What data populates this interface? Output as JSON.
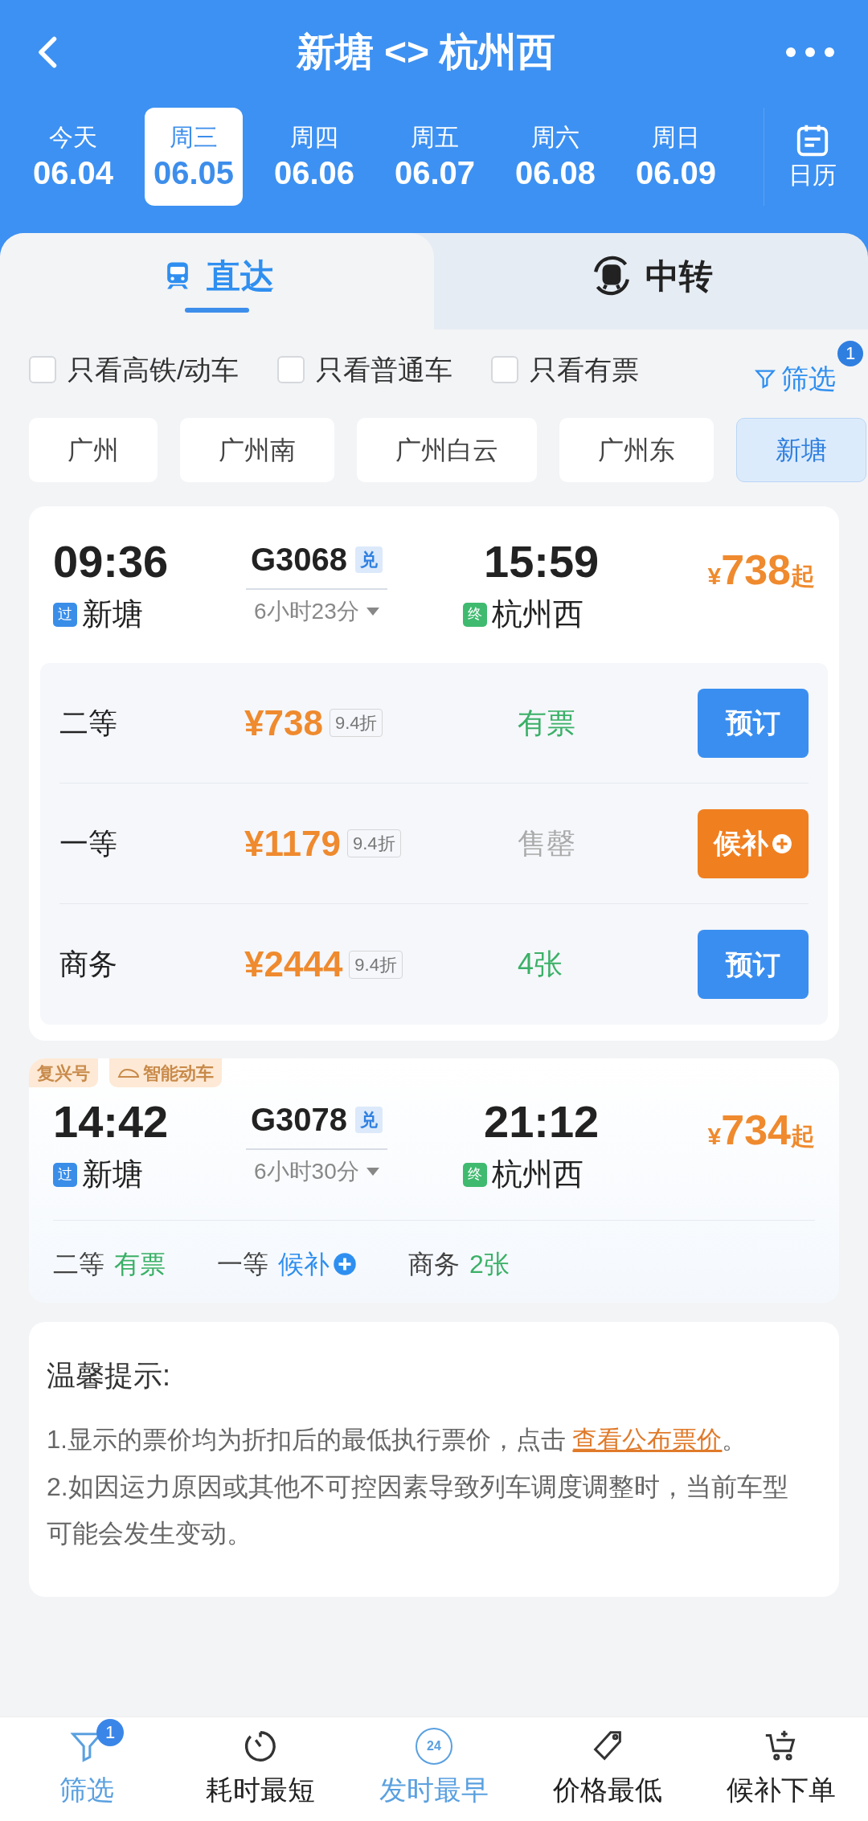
{
  "header": {
    "title": "新塘 <> 杭州西"
  },
  "dates": [
    {
      "weekday": "今天",
      "date": "06.04",
      "selected": false
    },
    {
      "weekday": "周三",
      "date": "06.05",
      "selected": true
    },
    {
      "weekday": "周四",
      "date": "06.06",
      "selected": false
    },
    {
      "weekday": "周五",
      "date": "06.07",
      "selected": false
    },
    {
      "weekday": "周六",
      "date": "06.08",
      "selected": false
    },
    {
      "weekday": "周日",
      "date": "06.09",
      "selected": false
    }
  ],
  "calendar_label": "日历",
  "mode_tabs": [
    {
      "label": "直达",
      "selected": true
    },
    {
      "label": "中转",
      "selected": false
    }
  ],
  "filters": [
    {
      "label": "只看高铁/动车",
      "checked": false
    },
    {
      "label": "只看普通车",
      "checked": false
    },
    {
      "label": "只看有票",
      "checked": false
    }
  ],
  "filter_link": {
    "label": "筛选",
    "badge": "1"
  },
  "stations": [
    {
      "label": "广州",
      "selected": false
    },
    {
      "label": "广州南",
      "selected": false
    },
    {
      "label": "广州白云",
      "selected": false
    },
    {
      "label": "广州东",
      "selected": false
    },
    {
      "label": "新塘",
      "selected": true
    }
  ],
  "trains": [
    {
      "kind": "expanded",
      "depart_time": "09:36",
      "depart_tag": "过",
      "depart_station": "新塘",
      "train_no": "G3068",
      "train_badge": "兑",
      "duration": "6小时23分",
      "arrive_time": "15:59",
      "arrive_tag": "终",
      "arrive_station": "杭州西",
      "price_prefix": "¥",
      "price": "738",
      "price_suffix": "起",
      "seats": [
        {
          "name": "二等",
          "price": "¥738",
          "discount": "9.4折",
          "status": "有票",
          "kind": "available",
          "button": "预订"
        },
        {
          "name": "一等",
          "price": "¥1179",
          "discount": "9.4折",
          "status": "售罄",
          "kind": "soldout",
          "button": "候补"
        },
        {
          "name": "商务",
          "price": "¥2444",
          "discount": "9.4折",
          "status": "4张",
          "kind": "available",
          "button": "预订"
        }
      ]
    },
    {
      "kind": "compact",
      "tags": [
        "复兴号",
        "智能动车"
      ],
      "depart_time": "14:42",
      "depart_tag": "过",
      "depart_station": "新塘",
      "train_no": "G3078",
      "train_badge": "兑",
      "duration": "6小时30分",
      "arrive_time": "21:12",
      "arrive_tag": "终",
      "arrive_station": "杭州西",
      "price_prefix": "¥",
      "price": "734",
      "price_suffix": "起",
      "seats": [
        {
          "name": "二等",
          "status": "有票",
          "kind": "available"
        },
        {
          "name": "一等",
          "status": "候补",
          "kind": "waitlist"
        },
        {
          "name": "商务",
          "status": "2张",
          "kind": "available"
        }
      ]
    }
  ],
  "tips": {
    "title": "温馨提示:",
    "line1": "1.显示的票价均为折扣后的最低执行票价，点击 ",
    "link": "查看公布票价",
    "line1_end": "。",
    "line2": "2.如因运力原因或其他不可控因素导致列车调度调整时，当前车型可能会发生变动。"
  },
  "bottom_bar": [
    {
      "label": "筛选",
      "selected": true,
      "badge": "1",
      "kind": "filter"
    },
    {
      "label": "耗时最短",
      "selected": false,
      "kind": "timer"
    },
    {
      "label": "发时最早",
      "selected": true,
      "kind": "clock24",
      "icon_text": "24"
    },
    {
      "label": "价格最低",
      "selected": false,
      "kind": "tag"
    },
    {
      "label": "候补下单",
      "selected": false,
      "kind": "cart"
    }
  ]
}
